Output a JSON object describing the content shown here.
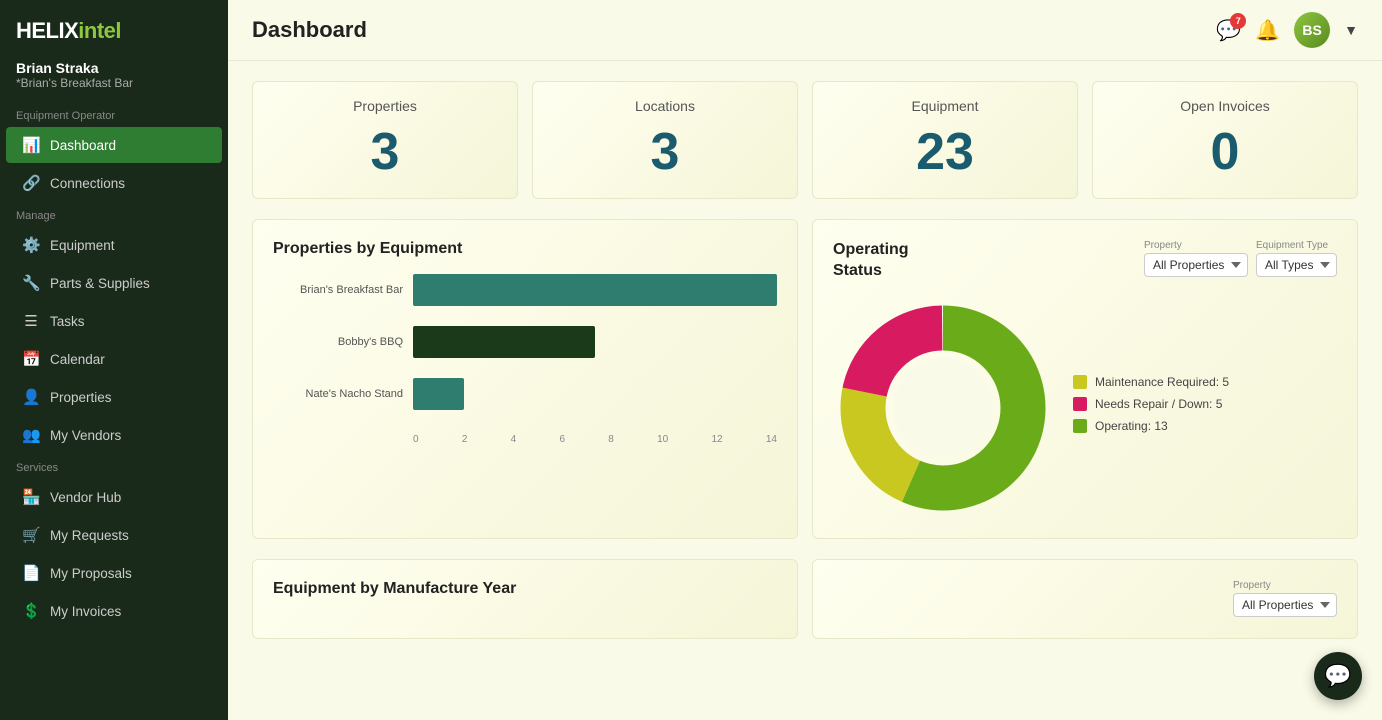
{
  "app": {
    "name_helix": "HELIX",
    "name_intel": "intel"
  },
  "user": {
    "name": "Brian Straka",
    "org": "*Brian's Breakfast Bar",
    "role": "Equipment Operator",
    "avatar_initials": "BS"
  },
  "sidebar": {
    "sections": [
      {
        "label": "Equipment Operator",
        "items": [
          {
            "id": "dashboard",
            "label": "Dashboard",
            "icon": "📊",
            "active": true
          },
          {
            "id": "connections",
            "label": "Connections",
            "icon": "🔗",
            "active": false
          }
        ]
      },
      {
        "label": "Manage",
        "items": [
          {
            "id": "equipment",
            "label": "Equipment",
            "icon": "⚙️",
            "active": false
          },
          {
            "id": "parts-supplies",
            "label": "Parts & Supplies",
            "icon": "🔧",
            "active": false
          },
          {
            "id": "tasks",
            "label": "Tasks",
            "icon": "☰",
            "active": false
          },
          {
            "id": "calendar",
            "label": "Calendar",
            "icon": "📅",
            "active": false
          },
          {
            "id": "properties",
            "label": "Properties",
            "icon": "👤",
            "active": false
          },
          {
            "id": "my-vendors",
            "label": "My Vendors",
            "icon": "👥",
            "active": false
          }
        ]
      },
      {
        "label": "Services",
        "items": [
          {
            "id": "vendor-hub",
            "label": "Vendor Hub",
            "icon": "🏪",
            "active": false
          },
          {
            "id": "my-requests",
            "label": "My Requests",
            "icon": "🛒",
            "active": false
          },
          {
            "id": "my-proposals",
            "label": "My Proposals",
            "icon": "📄",
            "active": false
          },
          {
            "id": "my-invoices",
            "label": "My Invoices",
            "icon": "💲",
            "active": false
          }
        ]
      }
    ]
  },
  "topbar": {
    "title": "Dashboard",
    "notification_count": "7"
  },
  "stats": [
    {
      "label": "Properties",
      "value": "3"
    },
    {
      "label": "Locations",
      "value": "3"
    },
    {
      "label": "Equipment",
      "value": "23"
    },
    {
      "label": "Open Invoices",
      "value": "0"
    }
  ],
  "properties_by_equipment": {
    "title": "Properties by Equipment",
    "bars": [
      {
        "label": "Brian's Breakfast Bar",
        "value": 14,
        "max": 14,
        "color": "teal"
      },
      {
        "label": "Bobby's BBQ",
        "value": 7,
        "max": 14,
        "color": "dark"
      },
      {
        "label": "Nate's Nacho Stand",
        "value": 2,
        "max": 14,
        "color": "teal"
      }
    ],
    "axis_labels": [
      "0",
      "2",
      "4",
      "6",
      "8",
      "10",
      "12",
      "14"
    ]
  },
  "operating_status": {
    "title": "Operating\nStatus",
    "property_label": "Property",
    "property_value": "All Properties",
    "equipment_type_label": "Equipment Type",
    "equipment_type_value": "All Types",
    "legend": [
      {
        "label": "Maintenance Required: 5",
        "color": "#c8c820"
      },
      {
        "label": "Needs Repair / Down: 5",
        "color": "#d81b60"
      },
      {
        "label": "Operating: 13",
        "color": "#6aab1a"
      }
    ],
    "donut": {
      "maintenance": 5,
      "repair": 5,
      "operating": 13,
      "total": 23
    }
  },
  "bottom_section": {
    "title": "Equipment by Manufacture Year",
    "property_label": "Property",
    "property_value": "All Properties"
  }
}
